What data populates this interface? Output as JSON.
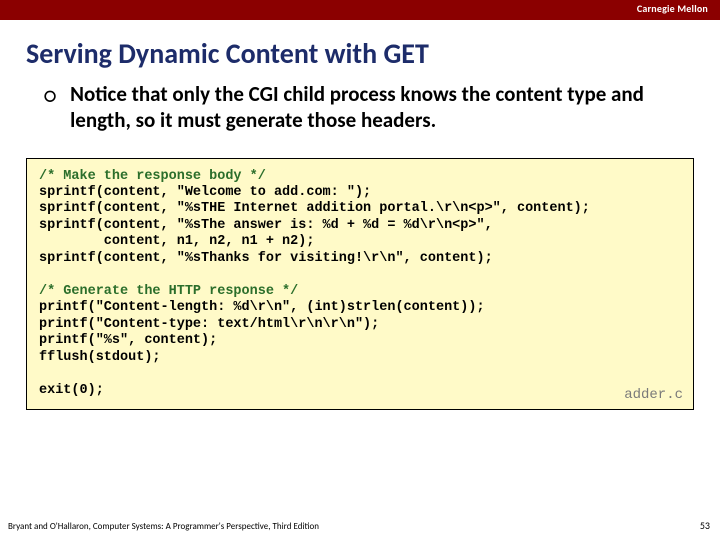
{
  "header": {
    "org": "Carnegie Mellon"
  },
  "title": "Serving Dynamic Content with GET",
  "bullet": {
    "glyph": "○",
    "text": "Notice that only the CGI child process knows the content type and length, so it must generate those headers."
  },
  "code": {
    "comment1": "/* Make the response body */",
    "l1": "sprintf(content, \"Welcome to add.com: \");",
    "l2": "sprintf(content, \"%sTHE Internet addition portal.\\r\\n<p>\", content);",
    "l3": "sprintf(content, \"%sThe answer is: %d + %d = %d\\r\\n<p>\",",
    "l4": "        content, n1, n2, n1 + n2);",
    "l5": "sprintf(content, \"%sThanks for visiting!\\r\\n\", content);",
    "comment2": "/* Generate the HTTP response */",
    "l6": "printf(\"Content-length: %d\\r\\n\", (int)strlen(content));",
    "l7": "printf(\"Content-type: text/html\\r\\n\\r\\n\");",
    "l8": "printf(\"%s\", content);",
    "l9": "fflush(stdout);",
    "l10": "exit(0);",
    "file": "adder.c"
  },
  "footer": {
    "left": "Bryant and O'Hallaron, Computer Systems: A Programmer's Perspective, Third Edition",
    "right": "53"
  }
}
